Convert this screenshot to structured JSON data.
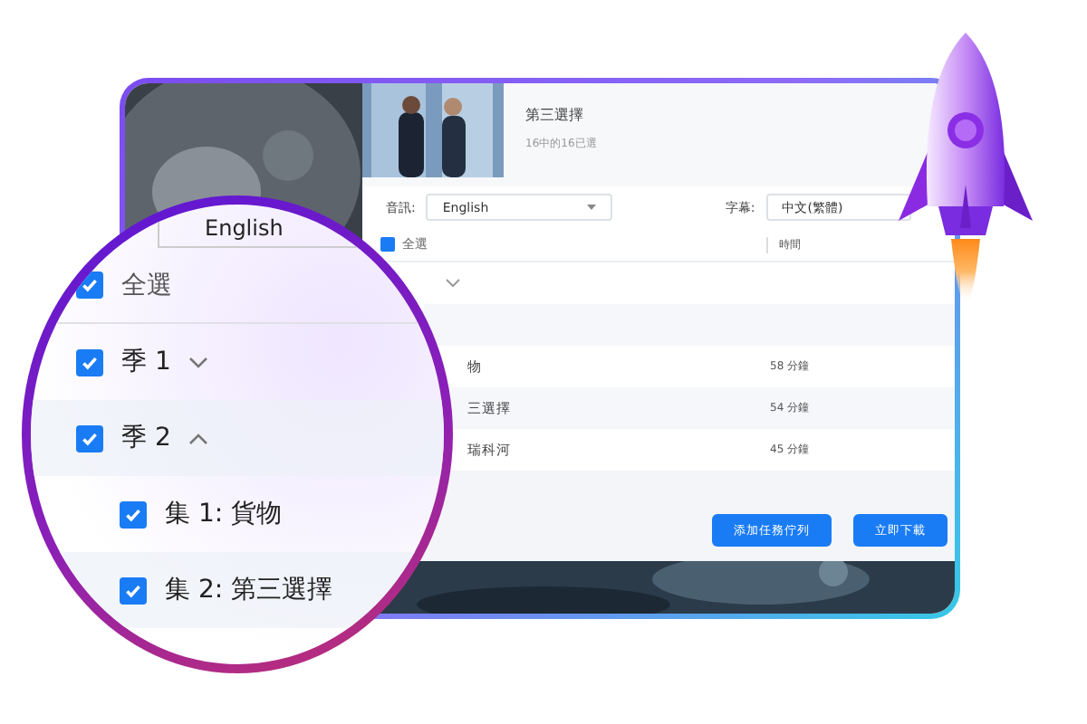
{
  "episode": {
    "title": "第三選擇",
    "subtitle": "16中的16已選"
  },
  "options": {
    "audio_label": "音訊:",
    "audio_value": "English",
    "subtitle_label": "字幕:",
    "subtitle_value": "中文(繁體)"
  },
  "table": {
    "select_all": {
      "label": "全選",
      "checked": true
    },
    "time_header": "時間",
    "rows": [
      {
        "kind": "season",
        "expanded": false
      },
      {
        "kind": "season"
      },
      {
        "kind": "episode",
        "name": "物",
        "time": "58 分鐘"
      },
      {
        "kind": "episode",
        "name": "三選擇",
        "time": "54 分鐘"
      },
      {
        "kind": "episode",
        "name": "瑞科河",
        "time": "45 分鐘"
      }
    ]
  },
  "buttons": [
    "添加任務佇列",
    "立即下載"
  ],
  "magnifier": {
    "dropdown_value": "English",
    "items": [
      {
        "kind": "all",
        "label": "全選",
        "checked": true
      },
      {
        "kind": "season",
        "label": "季 1",
        "checked": true,
        "expanded": false
      },
      {
        "kind": "season",
        "label": "季 2",
        "checked": true,
        "expanded": true
      },
      {
        "kind": "episode",
        "label": "集 1: 貨物",
        "checked": true
      },
      {
        "kind": "episode",
        "label": "集 2: 第三選擇",
        "checked": true
      }
    ]
  }
}
